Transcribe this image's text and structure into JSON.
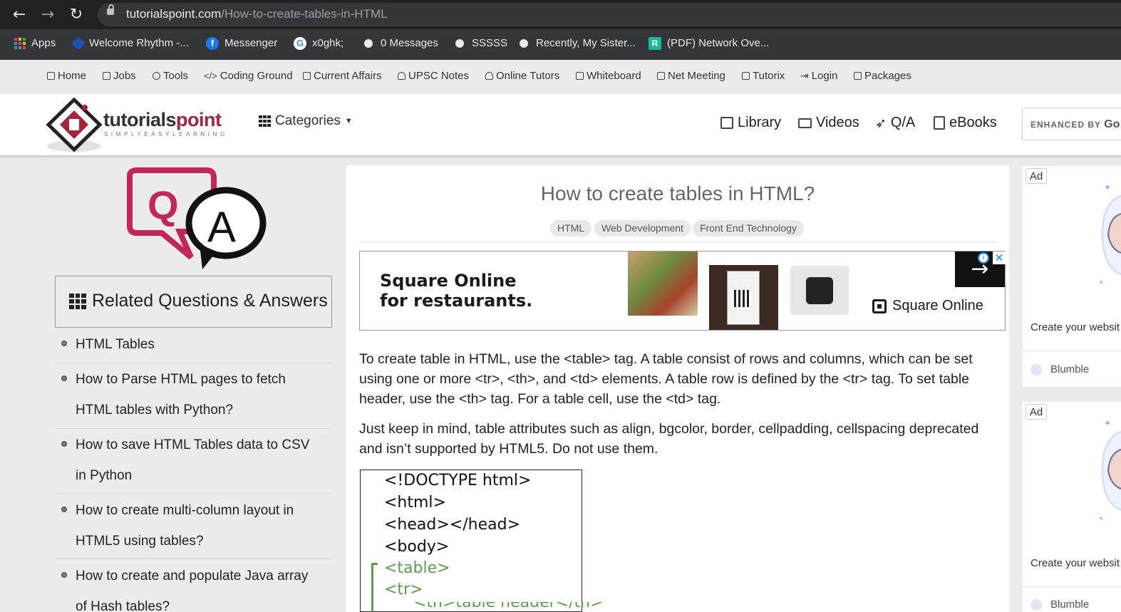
{
  "browser": {
    "url_domain": "tutorialspoint.com",
    "url_path": "/How-to-create-tables-in-HTML",
    "bookmarks": [
      "Apps",
      "Welcome Rhythm -...",
      "Messenger",
      "x0ghk;",
      "0 Messages",
      "SSSSS",
      "Recently, My Sister...",
      "(PDF) Network Ove..."
    ]
  },
  "topnav": [
    "Home",
    "Jobs",
    "Tools",
    "Coding Ground",
    "Current Affairs",
    "UPSC Notes",
    "Online Tutors",
    "Whiteboard",
    "Net Meeting",
    "Tutorix",
    "Login",
    "Packages"
  ],
  "header": {
    "logo_main": "tutorials",
    "logo_accent": "point",
    "logo_sub": "SIMPLYEASYLEARNING",
    "categories": "Categories",
    "nav": [
      "Library",
      "Videos",
      "Q/A",
      "eBooks"
    ],
    "search_enhanced": "ENHANCED BY",
    "search_brand": "Go"
  },
  "sidebar": {
    "related_title": "Related Questions & Answers",
    "questions": [
      [
        "HTML Tables"
      ],
      [
        "How to Parse HTML pages to fetch",
        "HTML tables with Python?"
      ],
      [
        "How to save HTML Tables data to CSV",
        "in Python"
      ],
      [
        "How to create multi-column layout in",
        "HTML5 using tables?"
      ],
      [
        "How to create and populate Java array",
        "of Hash tables?"
      ]
    ]
  },
  "article": {
    "title": "How to create tables in HTML?",
    "tags": [
      "HTML",
      "Web Development",
      "Front End Technology"
    ],
    "ad": {
      "headline_1": "Square Online",
      "headline_2": "for restaurants.",
      "brand": "Square Online"
    },
    "paragraph_1": "To create table in HTML, use the <table> tag. A table consist of rows and columns, which can be set using one or more <tr>, <th>, and <td> elements. A table row is defined by the <tr> tag. To set table header, use the <th> tag. For a table cell, use the <td> tag.",
    "paragraph_2": "Just keep in mind, table attributes such as align, bgcolor, border, cellpadding, cellspacing deprecated and isn’t supported by HTML5. Do not use them.",
    "code_lines": [
      "<!DOCTYPE html>",
      "<html>",
      "<head></head>",
      "<body>",
      "<table>",
      "<tr>",
      "<th>table header</th>"
    ]
  },
  "right_ads": {
    "label": "Ad",
    "text": "Create your websit",
    "brand": "Blumble"
  },
  "colors": {
    "brand": "#a8213f",
    "code_green": "#57a04c",
    "chrome_dark": "#202124"
  }
}
